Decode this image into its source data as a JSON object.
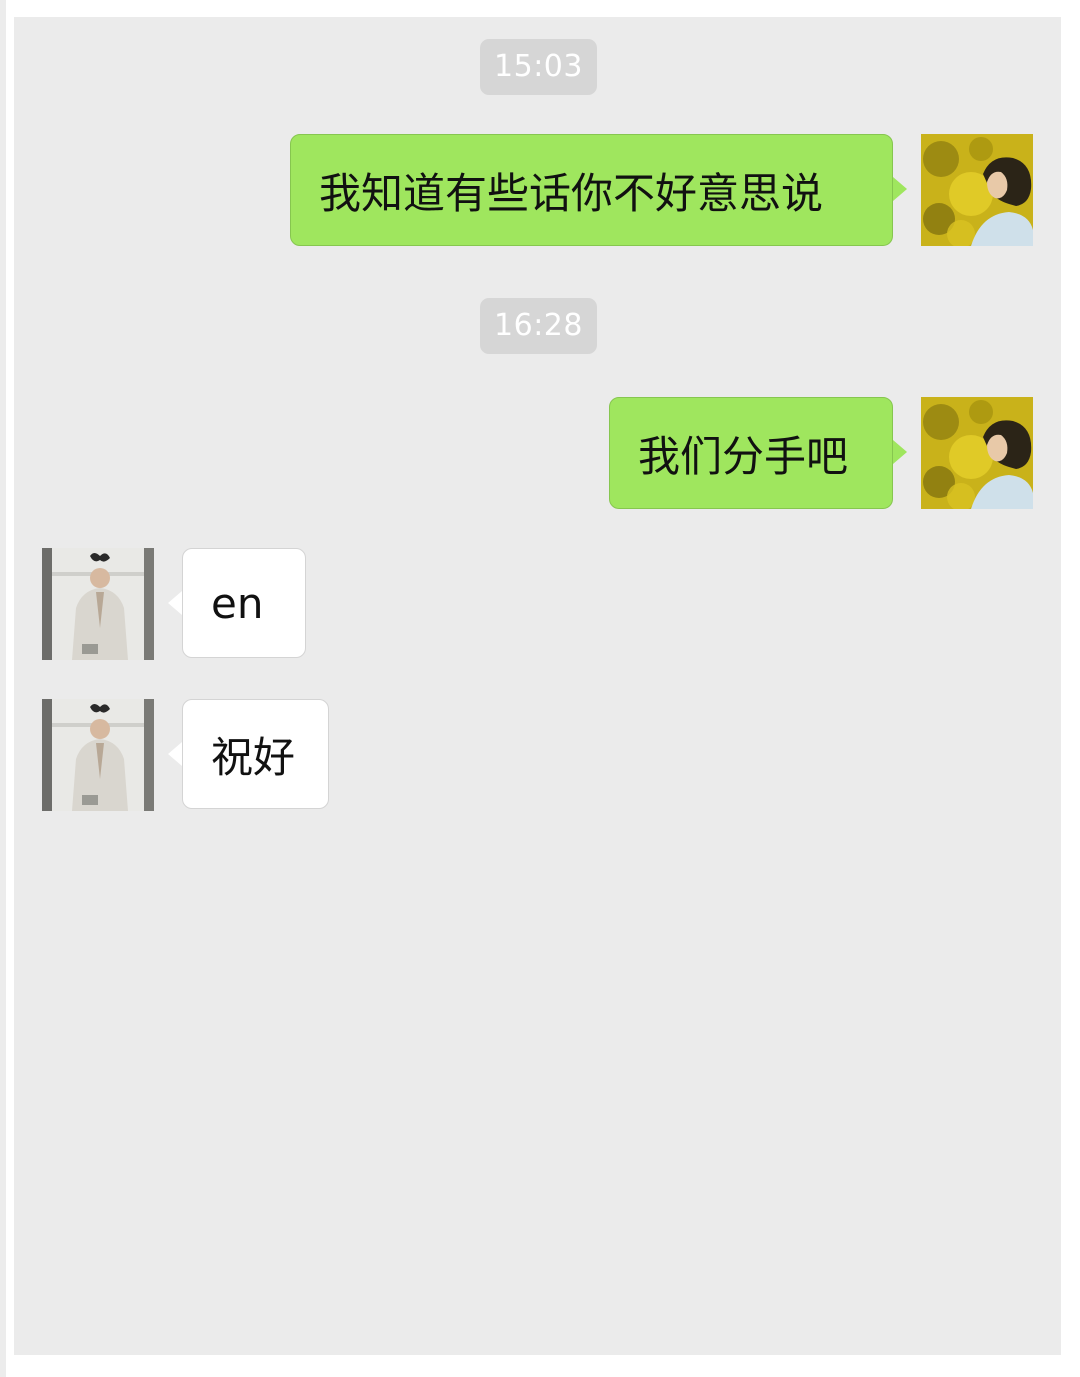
{
  "chat": {
    "timestamps": [
      "15:03",
      "16:28"
    ],
    "messages": [
      {
        "side": "sent",
        "text": "我知道有些话你不好意思说"
      },
      {
        "side": "sent",
        "text": "我们分手吧"
      },
      {
        "side": "received",
        "text": "en"
      },
      {
        "side": "received",
        "text": "祝好"
      }
    ]
  },
  "avatars": {
    "self": "avatar-yellow-foliage-portrait",
    "contact": "avatar-man-in-trench-coat"
  },
  "colors": {
    "chat_background": "#ebebeb",
    "sent_bubble": "#9fe65e",
    "received_bubble": "#ffffff",
    "timestamp_pill": "#d6d6d6"
  }
}
